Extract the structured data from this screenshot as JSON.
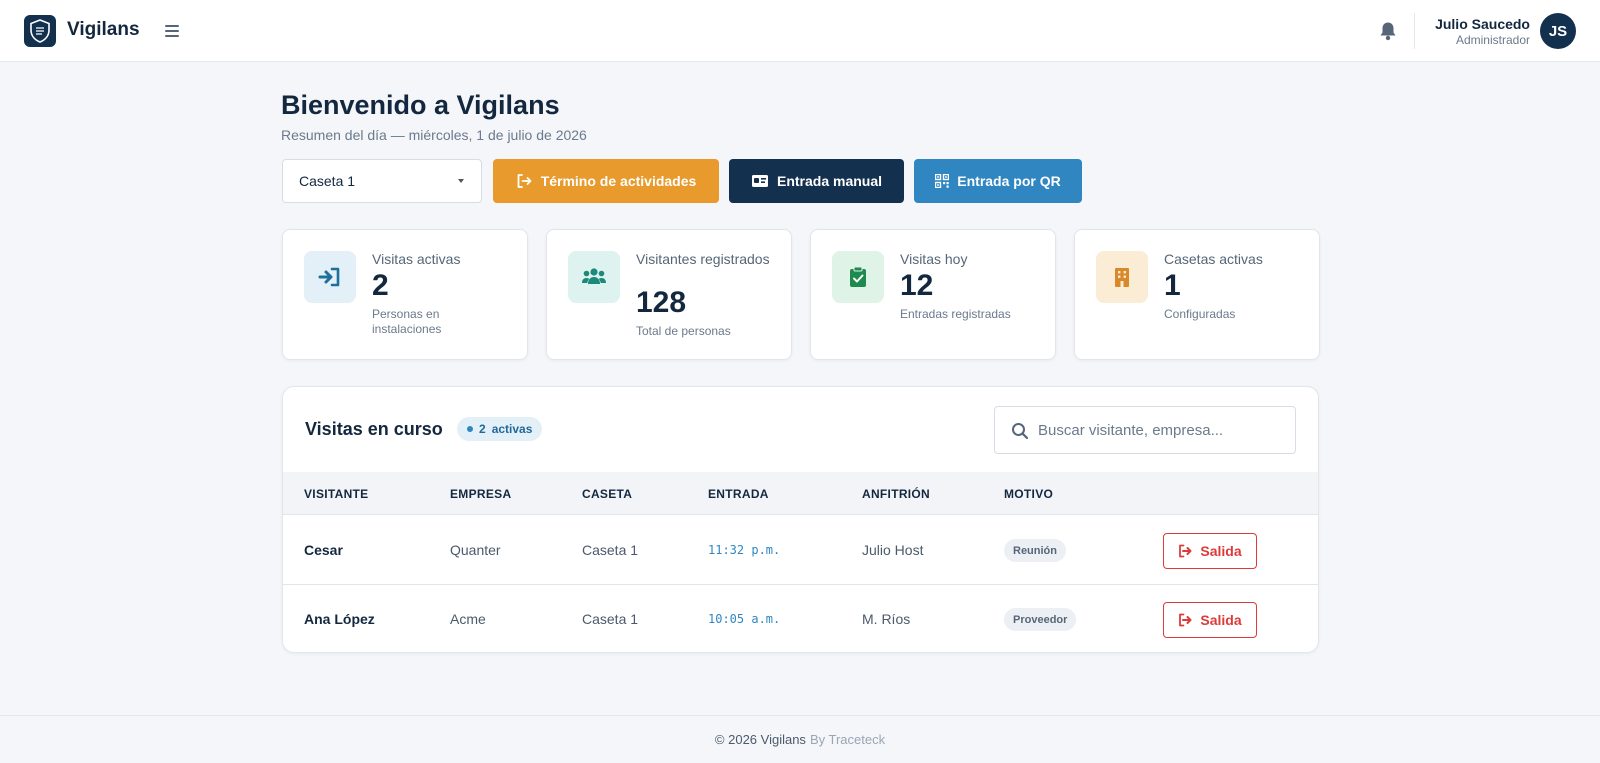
{
  "header": {
    "brand": "Vigilans",
    "user_name": "Julio Saucedo",
    "user_role": "Administrador",
    "avatar_initials": "JS"
  },
  "page": {
    "title": "Bienvenido a Vigilans",
    "subtitle": "Resumen del día — miércoles, 1 de julio de 2026"
  },
  "toolbar": {
    "selected_caseta": "Caseta 1",
    "end_activities_label": "Término de actividades",
    "manual_entry_label": "Entrada manual",
    "qr_entry_label": "Entrada por QR"
  },
  "stats": [
    {
      "label": "Visitas activas",
      "value": "2",
      "sub": "Personas en instalaciones",
      "icon": "sign-in-icon",
      "color": "#1f6f9b"
    },
    {
      "label": "Visitantes registrados",
      "value": "128",
      "sub": "Total de personas",
      "icon": "users-icon",
      "color": "#1b8a7a"
    },
    {
      "label": "Visitas hoy",
      "value": "12",
      "sub": "Entradas registradas",
      "icon": "clipboard-check-icon",
      "color": "#1f8a4d"
    },
    {
      "label": "Casetas activas",
      "value": "1",
      "sub": "Configuradas",
      "icon": "building-icon",
      "color": "#d9892a"
    }
  ],
  "visits": {
    "title": "Visitas en curso",
    "badge_count": "2",
    "badge_label": "activas",
    "search_placeholder": "Buscar visitante, empresa...",
    "columns": [
      "VISITANTE",
      "EMPRESA",
      "CASETA",
      "ENTRADA",
      "ANFITRIÓN",
      "MOTIVO"
    ],
    "rows": [
      {
        "visitante": "Cesar",
        "empresa": "Quanter",
        "caseta": "Caseta 1",
        "entrada": "11:32 p.m.",
        "anfitrion": "Julio Host",
        "motivo": "Reunión",
        "action": "Salida"
      },
      {
        "visitante": "Ana López",
        "empresa": "Acme",
        "caseta": "Caseta 1",
        "entrada": "10:05 a.m.",
        "anfitrion": "M. Ríos",
        "motivo": "Proveedor",
        "action": "Salida"
      }
    ]
  },
  "footer": {
    "copyright": "© 2026 Vigilans",
    "by": "By Traceteck"
  }
}
